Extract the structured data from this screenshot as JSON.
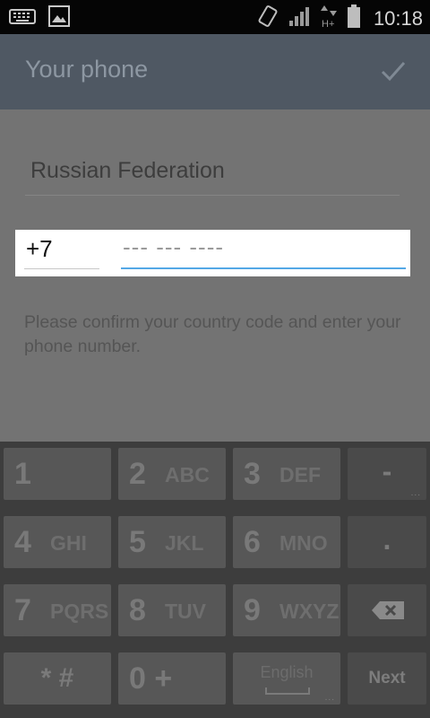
{
  "status_bar": {
    "icons": [
      "keyboard-icon",
      "image-icon",
      "vibrate-icon",
      "signal-icon",
      "data-hplus-icon",
      "battery-icon"
    ],
    "time": "10:18"
  },
  "header": {
    "title": "Your phone",
    "confirm_icon": "checkmark-icon"
  },
  "form": {
    "country": "Russian Federation",
    "country_code": "+7",
    "phone_placeholder": "--- --- ----",
    "hint": "Please confirm your country code and enter your phone number."
  },
  "keyboard": {
    "row1": [
      {
        "num": "1",
        "letters": ""
      },
      {
        "num": "2",
        "letters": "ABC"
      },
      {
        "num": "3",
        "letters": "DEF"
      }
    ],
    "row2": [
      {
        "num": "4",
        "letters": "GHI"
      },
      {
        "num": "5",
        "letters": "JKL"
      },
      {
        "num": "6",
        "letters": "MNO"
      }
    ],
    "row3": [
      {
        "num": "7",
        "letters": "PQRS"
      },
      {
        "num": "8",
        "letters": "TUV"
      },
      {
        "num": "9",
        "letters": "WXYZ"
      }
    ],
    "dash": "-",
    "dot": ".",
    "star_hash": "* #",
    "zero_plus": "0 +",
    "language": "English",
    "next": "Next",
    "ellipsis": "...",
    "backspace_icon": "backspace-icon"
  }
}
